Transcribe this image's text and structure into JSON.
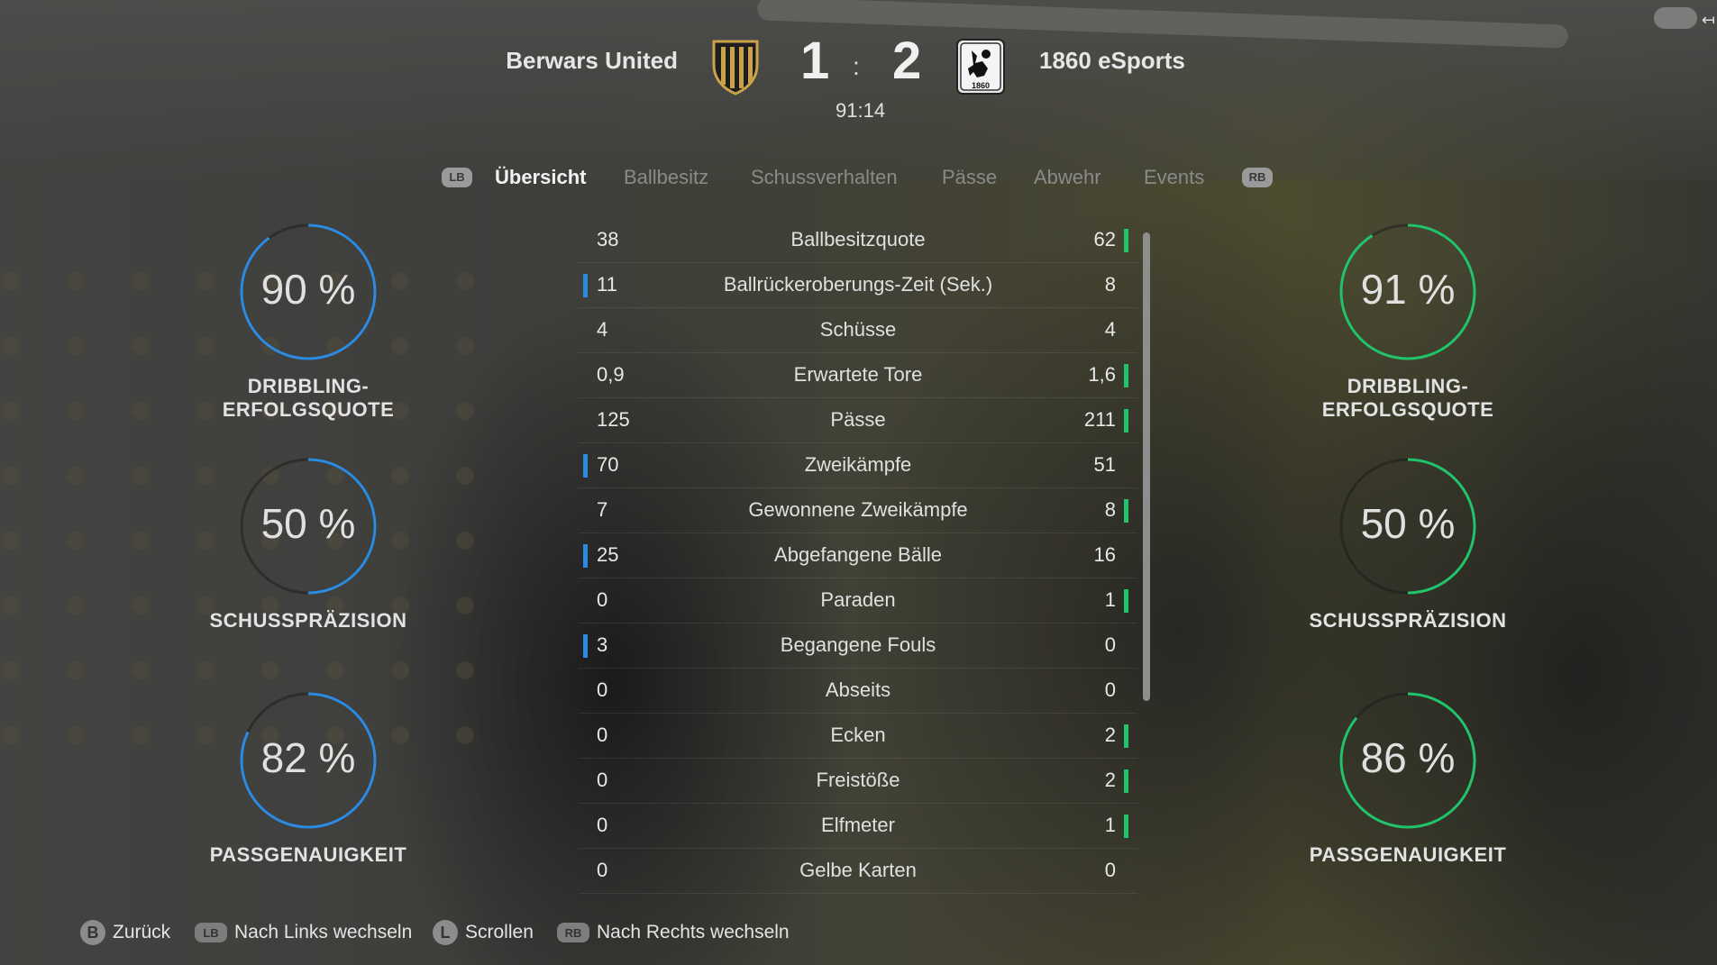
{
  "match": {
    "home_team": "Berwars United",
    "away_team": "1860 eSports",
    "home_score": "1",
    "separator": ":",
    "away_score": "2",
    "clock": "91:14",
    "away_crest_text": "1860"
  },
  "tabs": {
    "left_bumper": "LB",
    "right_bumper": "RB",
    "items": [
      "Übersicht",
      "Ballbesitz",
      "Schussverhalten",
      "Pässe",
      "Abwehr",
      "Events"
    ],
    "active": "Übersicht"
  },
  "gauges": {
    "home": [
      {
        "value_text": "90 %",
        "value": 0.9,
        "label": "DRIBBLING-ERFOLGSQUOTE"
      },
      {
        "value_text": "50 %",
        "value": 0.5,
        "label": "SCHUSSPRÄZISION"
      },
      {
        "value_text": "82 %",
        "value": 0.82,
        "label": "PASSGENAUIGKEIT"
      }
    ],
    "away": [
      {
        "value_text": "91 %",
        "value": 0.91,
        "label": "DRIBBLING-ERFOLGSQUOTE"
      },
      {
        "value_text": "50 %",
        "value": 0.5,
        "label": "SCHUSSPRÄZISION"
      },
      {
        "value_text": "86 %",
        "value": 0.86,
        "label": "PASSGENAUIGKEIT"
      }
    ],
    "home_color": "#2b8be0",
    "away_color": "#21c46a"
  },
  "stats": [
    {
      "home": "38",
      "name": "Ballbesitzquote",
      "away": "62",
      "lead": "away"
    },
    {
      "home": "11",
      "name": "Ballrückeroberungs-Zeit (Sek.)",
      "away": "8",
      "lead": "home"
    },
    {
      "home": "4",
      "name": "Schüsse",
      "away": "4",
      "lead": ""
    },
    {
      "home": "0,9",
      "name": "Erwartete Tore",
      "away": "1,6",
      "lead": "away"
    },
    {
      "home": "125",
      "name": "Pässe",
      "away": "211",
      "lead": "away"
    },
    {
      "home": "70",
      "name": "Zweikämpfe",
      "away": "51",
      "lead": "home"
    },
    {
      "home": "7",
      "name": "Gewonnene Zweikämpfe",
      "away": "8",
      "lead": "away"
    },
    {
      "home": "25",
      "name": "Abgefangene Bälle",
      "away": "16",
      "lead": "home"
    },
    {
      "home": "0",
      "name": "Paraden",
      "away": "1",
      "lead": "away"
    },
    {
      "home": "3",
      "name": "Begangene Fouls",
      "away": "0",
      "lead": "home"
    },
    {
      "home": "0",
      "name": "Abseits",
      "away": "0",
      "lead": ""
    },
    {
      "home": "0",
      "name": "Ecken",
      "away": "2",
      "lead": "away"
    },
    {
      "home": "0",
      "name": "Freistöße",
      "away": "2",
      "lead": "away"
    },
    {
      "home": "0",
      "name": "Elfmeter",
      "away": "1",
      "lead": "away"
    },
    {
      "home": "0",
      "name": "Gelbe Karten",
      "away": "0",
      "lead": ""
    }
  ],
  "footer": {
    "back_key": "B",
    "back_label": "Zurück",
    "left_key": "LB",
    "left_label": "Nach Links wechseln",
    "scroll_key": "L",
    "scroll_label": "Scrollen",
    "right_key": "RB",
    "right_label": "Nach Rechts wechseln"
  },
  "corner_glyph": "↤"
}
